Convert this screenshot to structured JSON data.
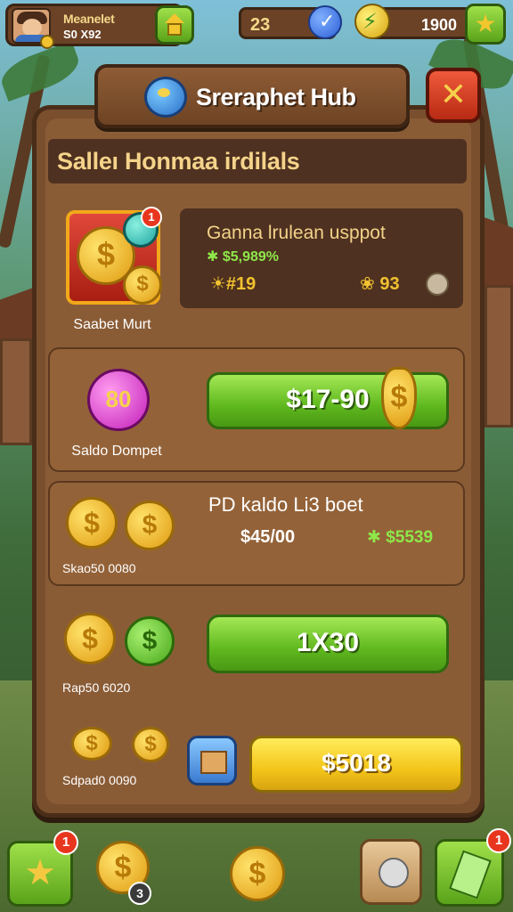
{
  "player": {
    "name": "Meanelet",
    "sub": "S0 X92"
  },
  "hud": {
    "gems": "23",
    "coins": "1900"
  },
  "header": {
    "title": "Sreraphet Hub",
    "close_label": "✕"
  },
  "section": {
    "title": "Salleı Honmaa irdilals"
  },
  "featured": {
    "shop_label": "Saabet Murt",
    "badge": "1",
    "title": "Ganna lrulean usppot",
    "subtitle": "✱ $5,989%",
    "stat1": "☀#19",
    "stat2": "❀ 93"
  },
  "offers": [
    {
      "icon_value": "80",
      "label": "Saldo Dompet",
      "price": "$17-90"
    },
    {
      "label": "Skao50 0080",
      "title": "PD kaldo Li3 boet",
      "price": "$45/00",
      "bonus": "✱ $5539"
    },
    {
      "label": "Rap50 6020",
      "price": "1X30"
    },
    {
      "label": "Sdpad0 0090",
      "price": "$5018"
    }
  ],
  "coin_glyph": "$",
  "bottom_nav": {
    "star_badge": "1",
    "coin_count": "3",
    "ticket_badge": "1",
    "star_glyph": "★"
  },
  "colors": {
    "wood": "#7a4f2e",
    "wood_dark": "#4a2d18",
    "green_button": "#5fb81e",
    "yellow_button": "#f4c51a",
    "gold_text": "#f4d38a",
    "bonus_green": "#8ee84a",
    "close_red": "#d23a1e"
  }
}
